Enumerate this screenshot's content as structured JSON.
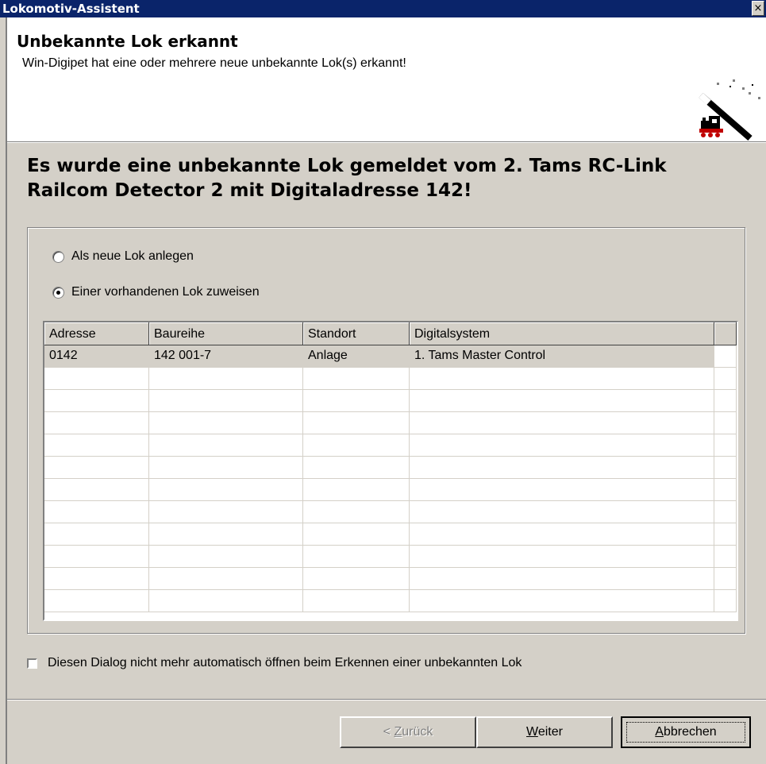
{
  "window": {
    "title": "Lokomotiv-Assistent",
    "close_glyph": "×"
  },
  "header": {
    "title": "Unbekannte Lok erkannt",
    "subtitle": "Win-Digipet hat eine oder mehrere neue unbekannte Lok(s) erkannt!",
    "icon": "wizard-wand-locomotive-icon"
  },
  "message": {
    "line1": "Es wurde eine unbekannte Lok gemeldet vom 2. Tams RC-Link",
    "line2": "Railcom Detector 2 mit Digitaladresse 142!"
  },
  "options": {
    "new_loco": {
      "label": "Als neue Lok anlegen",
      "checked": false
    },
    "assign_existing": {
      "label": "Einer vorhandenen Lok zuweisen",
      "checked": true
    }
  },
  "grid": {
    "columns": [
      "Adresse",
      "Baureihe",
      "Standort",
      "Digitalsystem"
    ],
    "rows": [
      {
        "adresse": "0142",
        "baureihe": "142 001-7",
        "standort": "Anlage",
        "digitalsystem": "1. Tams Master Control",
        "selected": true
      }
    ]
  },
  "checkbox": {
    "label": "Diesen Dialog nicht mehr automatisch öffnen beim Erkennen einer  unbekannten Lok",
    "checked": false
  },
  "buttons": {
    "back": {
      "prefix": "< ",
      "mnemonic": "Z",
      "rest": "urück",
      "enabled": false
    },
    "next": {
      "mnemonic": "W",
      "rest": "eiter",
      "enabled": true
    },
    "cancel": {
      "mnemonic": "A",
      "rest": "bbrechen",
      "enabled": true,
      "default": true
    }
  },
  "colors": {
    "titlebar": "#0a246a",
    "face": "#d4d0c8",
    "header_bg": "#ffffff"
  }
}
